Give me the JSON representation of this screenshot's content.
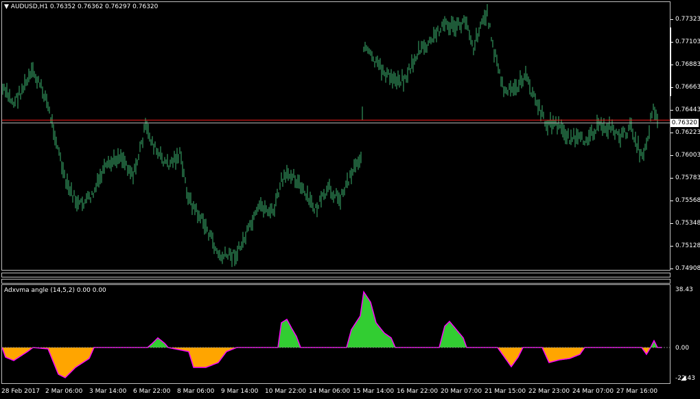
{
  "chart": {
    "title": "AUDUSD,H1  0.76352 0.76362 0.76297 0.76320",
    "indicator_title": "Adxvma angle (14,5,2) 0.00 0.00",
    "current_price_label": "0.76320",
    "price_axis": [
      "0.77323",
      "0.77103",
      "0.76883",
      "0.76663",
      "0.76443",
      "0.76223",
      "0.76003",
      "0.75783",
      "0.75568",
      "0.75348",
      "0.75128",
      "0.74908"
    ],
    "indicator_axis": [
      "38.43",
      "0.00",
      "-22.43"
    ],
    "time_axis": [
      "28 Feb 2017",
      "2 Mar 06:00",
      "3 Mar 14:00",
      "6 Mar 22:00",
      "8 Mar 06:00",
      "9 Mar 14:00",
      "10 Mar 22:00",
      "14 Mar 06:00",
      "15 Mar 14:00",
      "16 Mar 22:00",
      "20 Mar 07:00",
      "21 Mar 15:00",
      "22 Mar 23:00",
      "24 Mar 07:00",
      "27 Mar 16:00"
    ],
    "colors": {
      "candles": "#3cb371",
      "bid_line": "#ff2020",
      "ask_line": "#c0c0c0",
      "hist_up": "#32cd32",
      "hist_down": "#ffa500",
      "indicator_line": "#ff00ff"
    }
  }
}
